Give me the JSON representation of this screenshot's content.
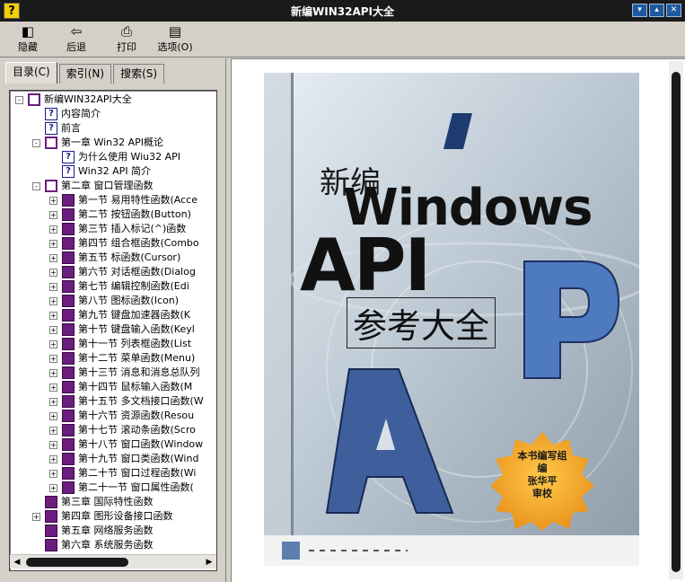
{
  "window": {
    "title": "新编WIN32API大全",
    "app_icon": "?"
  },
  "toolbar": {
    "hide": "隐藏",
    "back": "后退",
    "print": "打印",
    "options": "选项(O)"
  },
  "tabs": {
    "contents": "目录(C)",
    "index": "索引(N)",
    "search": "搜索(S)"
  },
  "tree": [
    {
      "level": 0,
      "icon": "book-open",
      "exp": "-",
      "text": "新编WIN32API大全"
    },
    {
      "level": 1,
      "icon": "help",
      "text": "内容简介"
    },
    {
      "level": 1,
      "icon": "help",
      "text": "前言"
    },
    {
      "level": 1,
      "icon": "book-open",
      "exp": "-",
      "text": "第一章 Win32 API概论"
    },
    {
      "level": 2,
      "icon": "help",
      "text": "为什么使用 Wiu32 API"
    },
    {
      "level": 2,
      "icon": "help",
      "text": "Win32 API 简介"
    },
    {
      "level": 1,
      "icon": "book-open",
      "exp": "-",
      "text": "第二章 窗口管理函数"
    },
    {
      "level": 2,
      "icon": "book",
      "exp": "+",
      "text": "第一节 易用特性函数(Acce"
    },
    {
      "level": 2,
      "icon": "book",
      "exp": "+",
      "text": "第二节 按钮函数(Button)"
    },
    {
      "level": 2,
      "icon": "book",
      "exp": "+",
      "text": "第三节 插入标记(^)函数"
    },
    {
      "level": 2,
      "icon": "book",
      "exp": "+",
      "text": "第四节 组合框函数(Combo"
    },
    {
      "level": 2,
      "icon": "book",
      "exp": "+",
      "text": "第五节 标函数(Cursor)"
    },
    {
      "level": 2,
      "icon": "book",
      "exp": "+",
      "text": "第六节 对话框函数(Dialog"
    },
    {
      "level": 2,
      "icon": "book",
      "exp": "+",
      "text": "第七节 编辑控制函数(Edi"
    },
    {
      "level": 2,
      "icon": "book",
      "exp": "+",
      "text": "第八节 图标函数(Icon)"
    },
    {
      "level": 2,
      "icon": "book",
      "exp": "+",
      "text": "第九节 键盘加速器函数(K"
    },
    {
      "level": 2,
      "icon": "book",
      "exp": "+",
      "text": "第十节 键盘输入函数(Keyl"
    },
    {
      "level": 2,
      "icon": "book",
      "exp": "+",
      "text": "第十一节 列表框函数(List"
    },
    {
      "level": 2,
      "icon": "book",
      "exp": "+",
      "text": "第十二节 菜单函数(Menu)"
    },
    {
      "level": 2,
      "icon": "book",
      "exp": "+",
      "text": "第十三节 消息和消息总队列"
    },
    {
      "level": 2,
      "icon": "book",
      "exp": "+",
      "text": "第十四节 鼠标输入函数(M"
    },
    {
      "level": 2,
      "icon": "book",
      "exp": "+",
      "text": "第十五节 多文档接口函数(W"
    },
    {
      "level": 2,
      "icon": "book",
      "exp": "+",
      "text": "第十六节 资源函数(Resou"
    },
    {
      "level": 2,
      "icon": "book",
      "exp": "+",
      "text": "第十七节 滚动条函数(Scro"
    },
    {
      "level": 2,
      "icon": "book",
      "exp": "+",
      "text": "第十八节 窗口函数(Window"
    },
    {
      "level": 2,
      "icon": "book",
      "exp": "+",
      "text": "第十九节 窗口类函数(Wind"
    },
    {
      "level": 2,
      "icon": "book",
      "exp": "+",
      "text": "第二十节 窗口过程函数(Wi"
    },
    {
      "level": 2,
      "icon": "book",
      "exp": "+",
      "text": "第二十一节 窗口属性函数("
    },
    {
      "level": 1,
      "icon": "book",
      "text": "第三章 国际特性函数"
    },
    {
      "level": 1,
      "icon": "book",
      "exp": "+",
      "text": "第四章 图形设备接口函数"
    },
    {
      "level": 1,
      "icon": "book",
      "text": "第五章 网络服务函数"
    },
    {
      "level": 1,
      "icon": "book",
      "text": "第六章 系统服务函数"
    }
  ],
  "cover": {
    "title_small": "新编",
    "title_big1": "Windows",
    "title_big2": "API",
    "subtitle": "参考大全",
    "badge_line1": "本书编写组",
    "badge_line2": "编",
    "badge_line3": "张华平",
    "badge_line4": "审校"
  },
  "colors": {
    "titlebar": "#1a1a1a",
    "book": "#6b1e7e",
    "badge": "#f0a51c"
  }
}
